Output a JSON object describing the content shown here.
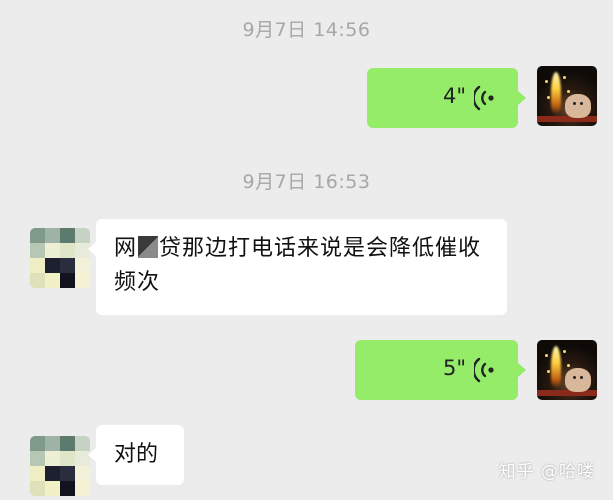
{
  "chat": {
    "timestamps": [
      "9月7日 14:56",
      "9月7日 16:53"
    ],
    "messages": [
      {
        "type": "voice",
        "from": "self",
        "duration": "4\""
      },
      {
        "type": "text",
        "from": "other",
        "text_before": "网",
        "text_after": "贷那边打电话来说是会降低催收频次"
      },
      {
        "type": "voice",
        "from": "self",
        "duration": "5\""
      },
      {
        "type": "text",
        "from": "other",
        "text": "对的"
      }
    ]
  },
  "watermark": {
    "text": "知乎 @哈喽"
  },
  "colors": {
    "background": "#ececec",
    "self_bubble": "#95ec69",
    "other_bubble": "#ffffff",
    "timestamp": "#a7a7a7",
    "voice_icon": "#222222"
  },
  "icons": {
    "voice": "voice-wave-icon"
  }
}
